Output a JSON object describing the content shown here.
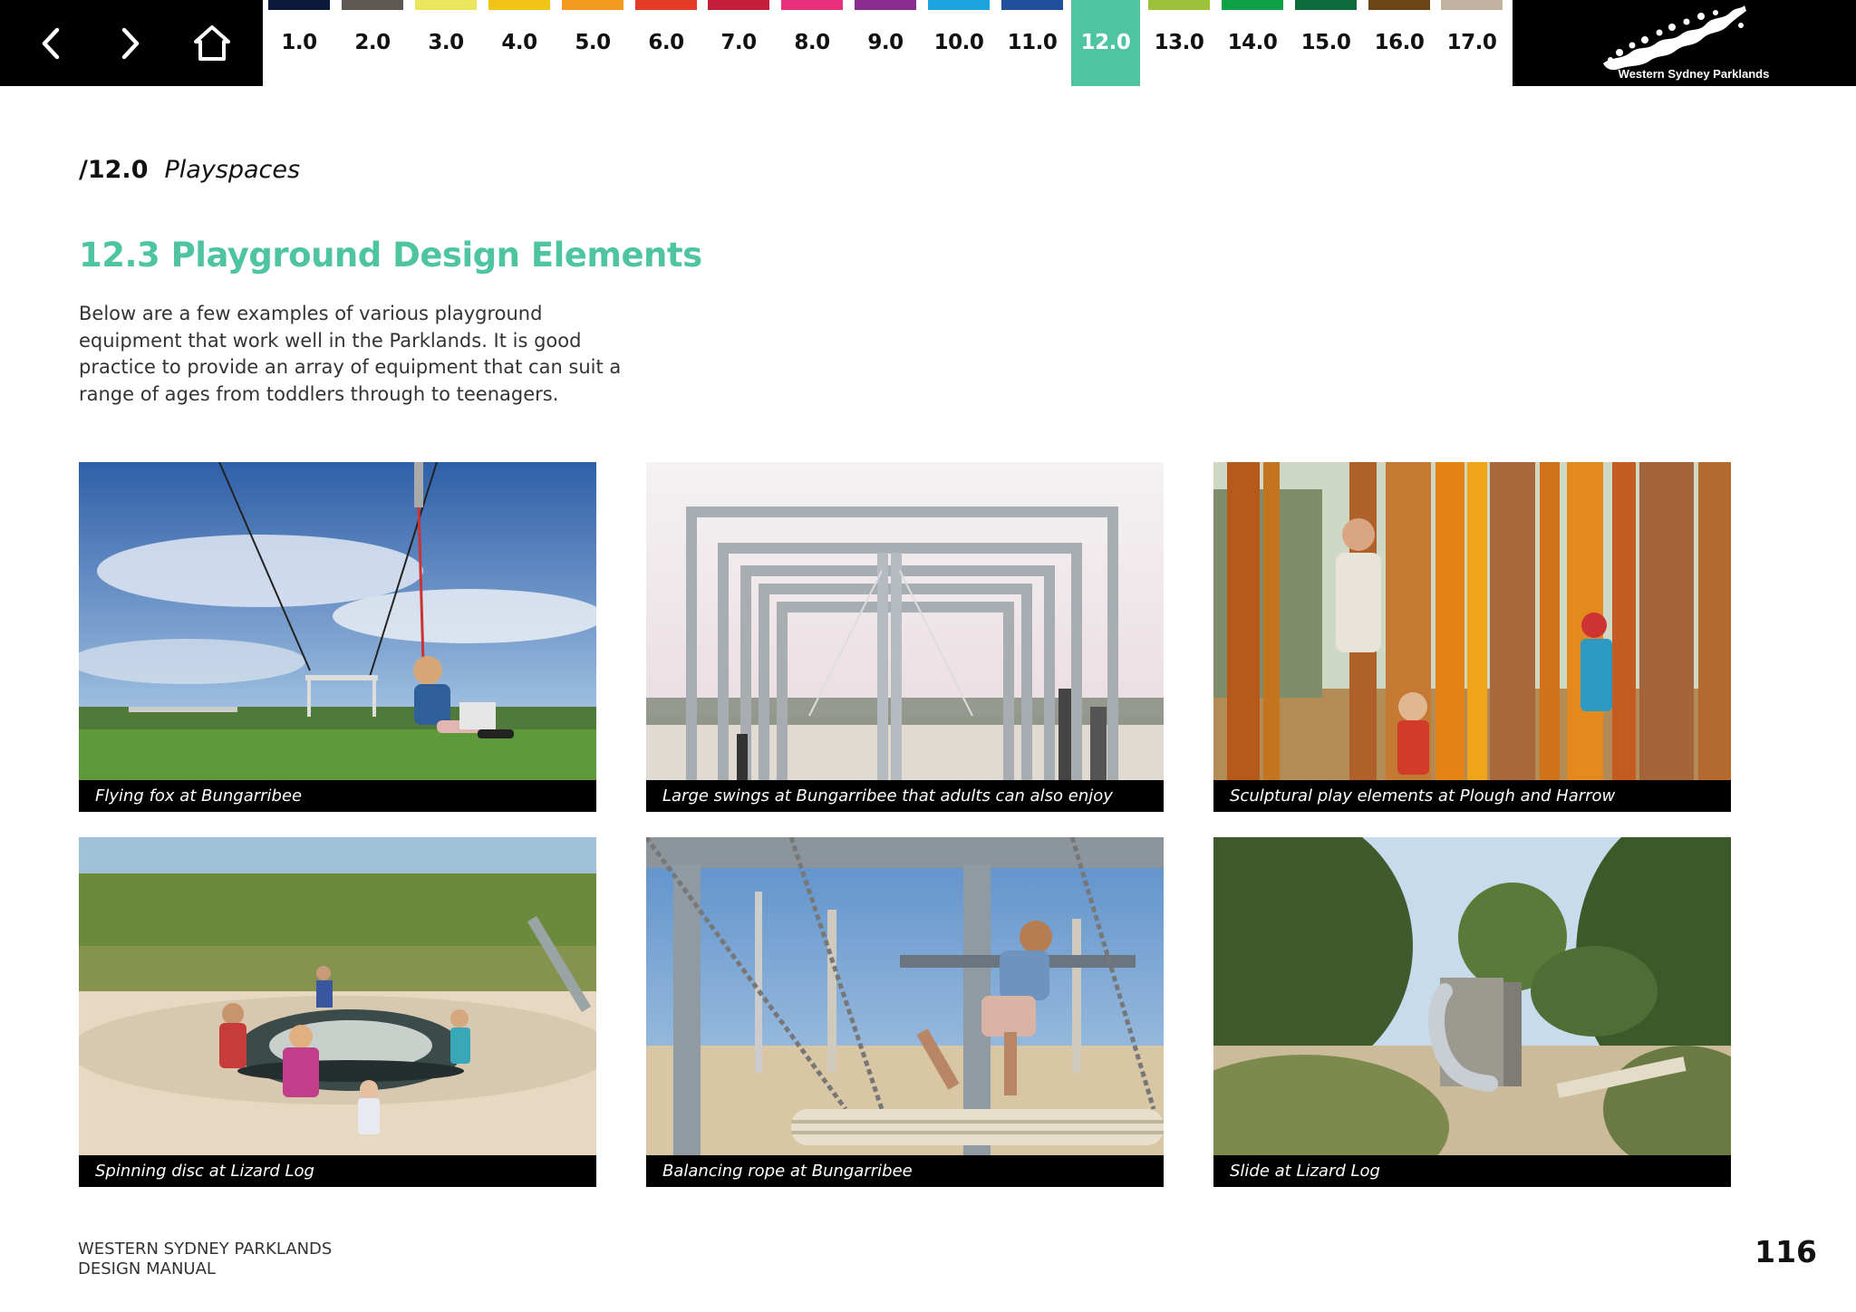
{
  "nav": {
    "chapters": [
      {
        "label": "1.0",
        "color": "#0c1a3a"
      },
      {
        "label": "2.0",
        "color": "#5e5753"
      },
      {
        "label": "3.0",
        "color": "#ebe55b"
      },
      {
        "label": "4.0",
        "color": "#f2c418"
      },
      {
        "label": "5.0",
        "color": "#f39a1f"
      },
      {
        "label": "6.0",
        "color": "#e33b26"
      },
      {
        "label": "7.0",
        "color": "#c31f3d"
      },
      {
        "label": "8.0",
        "color": "#e8307d"
      },
      {
        "label": "9.0",
        "color": "#8a2d8f"
      },
      {
        "label": "10.0",
        "color": "#1ba3dd"
      },
      {
        "label": "11.0",
        "color": "#1f4f9b"
      },
      {
        "label": "12.0",
        "color": "#4ec4a1",
        "active": true
      },
      {
        "label": "13.0",
        "color": "#9cc23a"
      },
      {
        "label": "14.0",
        "color": "#10a045"
      },
      {
        "label": "15.0",
        "color": "#0d6a3a"
      },
      {
        "label": "16.0",
        "color": "#6b4515"
      },
      {
        "label": "17.0",
        "color": "#c2b3a0"
      }
    ],
    "logo_text": "Western Sydney Parklands"
  },
  "header": {
    "section_number": "/12.0",
    "section_name": "Playspaces",
    "title": "12.3 Playground Design Elements",
    "intro": "Below are a few examples of various playground equipment that work well in the Parklands. It is good practice to provide an array of equipment that can suit a range of ages from toddlers through to teenagers."
  },
  "photos": [
    {
      "caption": "Flying fox at Bungarribee"
    },
    {
      "caption": "Large swings at Bungarribee that adults can also enjoy"
    },
    {
      "caption": "Sculptural play elements at Plough and Harrow"
    },
    {
      "caption": "Spinning disc at Lizard Log"
    },
    {
      "caption": "Balancing rope at Bungarribee"
    },
    {
      "caption": "Slide at Lizard Log"
    }
  ],
  "footer": {
    "line1": "WESTERN SYDNEY PARKLANDS",
    "line2": "DESIGN MANUAL",
    "page_number": "116"
  },
  "colors": {
    "accent": "#4ec4a1"
  }
}
